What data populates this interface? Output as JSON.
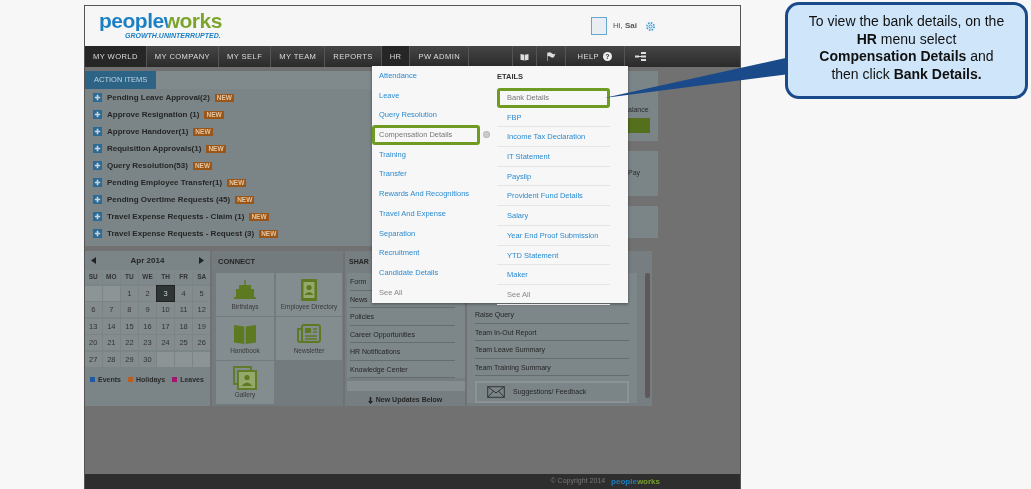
{
  "header": {
    "logo": "peopleworks",
    "tagline": "GROWTH.UNINTERRUPTED.",
    "greeting": "Hi, **Sai**"
  },
  "nav": {
    "items": [
      {
        "label": "MY WORLD",
        "active": true
      },
      {
        "label": "MY COMPANY",
        "active": false
      },
      {
        "label": "MY SELF",
        "active": false
      },
      {
        "label": "MY TEAM",
        "active": false
      },
      {
        "label": "REPORTS",
        "active": false
      },
      {
        "label": "HR",
        "active": true
      },
      {
        "label": "PW ADMIN",
        "active": false
      }
    ],
    "help": "HELP",
    "help_icon": "?"
  },
  "action_items": {
    "title": "ACTION ITEMS",
    "items": [
      {
        "label": "Pending Leave Approval(2)",
        "badge": "NEW"
      },
      {
        "label": "Approve Resignation (1)",
        "badge": "NEW"
      },
      {
        "label": "Approve Handover(1)",
        "badge": "NEW"
      },
      {
        "label": "Requisition Approvals(1)",
        "badge": "NEW"
      },
      {
        "label": "Query Resolution(53)",
        "badge": "NEW"
      },
      {
        "label": "Pending Employee Transfer(1)",
        "badge": "NEW"
      },
      {
        "label": "Pending Overtime Requests (45)",
        "badge": "NEW"
      },
      {
        "label": "Travel Expense Requests - Claim (1)",
        "badge": "NEW"
      },
      {
        "label": "Travel Expense Requests - Request (3)",
        "badge": "NEW"
      }
    ]
  },
  "summary_cards": [
    {
      "label": "alance",
      "has_button": true
    },
    {
      "label": "Pay",
      "has_button": false
    },
    {
      "has_button": false
    }
  ],
  "calendar": {
    "month": "Apr 2014",
    "weekdays": [
      "SU",
      "MO",
      "TU",
      "WE",
      "TH",
      "FR",
      "SA"
    ],
    "weeks": [
      [
        {
          "kind": "blank"
        },
        {
          "kind": "blank"
        },
        {
          "day": "1",
          "selected": false
        },
        {
          "day": "2",
          "selected": false
        },
        {
          "day": "3",
          "selected": true
        },
        {
          "day": "4",
          "selected": false
        },
        {
          "day": "5",
          "selected": false
        }
      ],
      [
        {
          "day": "6",
          "selected": false
        },
        {
          "day": "7",
          "selected": false
        },
        {
          "day": "8",
          "selected": false
        },
        {
          "day": "9",
          "selected": false
        },
        {
          "day": "10",
          "selected": false
        },
        {
          "day": "11",
          "selected": false
        },
        {
          "day": "12",
          "selected": false
        }
      ],
      [
        {
          "day": "13",
          "selected": false
        },
        {
          "day": "14",
          "selected": false
        },
        {
          "day": "15",
          "selected": false
        },
        {
          "day": "16",
          "selected": false
        },
        {
          "day": "17",
          "selected": false
        },
        {
          "day": "18",
          "selected": false
        },
        {
          "day": "19",
          "selected": false
        }
      ],
      [
        {
          "day": "20",
          "selected": false
        },
        {
          "day": "21",
          "selected": false
        },
        {
          "day": "22",
          "selected": false
        },
        {
          "day": "23",
          "selected": false
        },
        {
          "day": "24",
          "selected": false
        },
        {
          "day": "25",
          "selected": false
        },
        {
          "day": "26",
          "selected": false
        }
      ],
      [
        {
          "day": "27",
          "selected": false
        },
        {
          "day": "28",
          "selected": false
        },
        {
          "day": "29",
          "selected": false
        },
        {
          "day": "30",
          "selected": false
        },
        {
          "kind": "blank"
        },
        {
          "kind": "blank"
        },
        {
          "kind": "blank"
        }
      ]
    ],
    "legend": [
      {
        "label": "Events",
        "color": "#1e5aa0"
      },
      {
        "label": "Holidays",
        "color": "#b85e1e"
      },
      {
        "label": "Leaves",
        "color": "#a0176e"
      }
    ]
  },
  "connect": {
    "title": "CONNECT",
    "tiles": [
      {
        "label": "Birthdays",
        "kind": "cake"
      },
      {
        "label": "Employee Directory",
        "kind": "contacts"
      },
      {
        "label": "Handbook",
        "kind": "book"
      },
      {
        "label": "Newsletter",
        "kind": "newspaper"
      },
      {
        "label": "Gallery",
        "kind": "photos"
      }
    ]
  },
  "shared": {
    "title": "SHAR",
    "items": [
      "Form",
      "News",
      "Policies",
      "Career Opportunities",
      "HR Notifications",
      "Knowledge Center"
    ],
    "footer": "New Updates Below"
  },
  "quick_links": {
    "items": [
      "Raise Query",
      "Team In-Out Report",
      "Team Leave Summary",
      "Team Training Summary"
    ],
    "button": "Suggestions/ Feedback"
  },
  "menu": {
    "columns": [
      {
        "items": [
          {
            "label": "Attendance",
            "highlighted": false
          },
          {
            "label": "Leave",
            "highlighted": false
          },
          {
            "label": "Query Resolution",
            "highlighted": false
          },
          {
            "label": "Compensation Details",
            "highlighted": true,
            "indicator": true
          },
          {
            "label": "Training",
            "highlighted": false
          },
          {
            "label": "Transfer",
            "highlighted": false
          },
          {
            "label": "Rewards And Recognitions",
            "highlighted": false
          },
          {
            "label": "Travel And Expense",
            "highlighted": false
          },
          {
            "label": "Separation",
            "highlighted": false
          },
          {
            "label": "Recruitment",
            "highlighted": false
          },
          {
            "label": "Candidate Details",
            "highlighted": false
          },
          {
            "label": "See All",
            "highlighted": false,
            "kind": "more"
          }
        ]
      },
      {
        "heading": "ETAILS",
        "items": [
          {
            "label": "Bank Details",
            "highlighted": true
          },
          {
            "label": "FBP",
            "highlighted": false
          },
          {
            "label": "Income Tax Declaration",
            "highlighted": false
          },
          {
            "label": "IT Statement",
            "highlighted": false
          },
          {
            "label": "Payslip",
            "highlighted": false
          },
          {
            "label": "Provident Fund Details",
            "highlighted": false
          },
          {
            "label": "Salary",
            "highlighted": false
          },
          {
            "label": "Year End Proof Submission",
            "highlighted": false
          },
          {
            "label": "YTD Statement",
            "highlighted": false
          },
          {
            "label": "Maker",
            "highlighted": false
          },
          {
            "label": "See All",
            "highlighted": false,
            "kind": "more"
          }
        ]
      }
    ]
  },
  "footer": {
    "copyright": "© Copyright 2014",
    "logo": "peopleworks"
  },
  "callout": {
    "text": "To view the bank details, on the **HR** menu select **Compensation Details** and then click **Bank Details.**"
  }
}
